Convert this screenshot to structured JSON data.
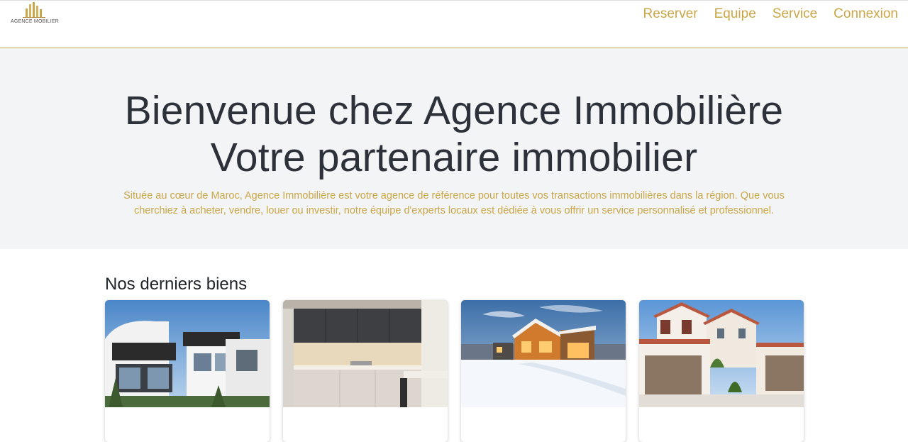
{
  "header": {
    "logo_text": "AGENCE MOBILIER",
    "nav": [
      "Reserver",
      "Equipe",
      "Service",
      "Connexion"
    ]
  },
  "hero": {
    "title_line1": "Bienvenue chez Agence Immobilière",
    "title_line2": "Votre partenaire immobilier",
    "description": "Située au cœur de Maroc, Agence Immobilière est votre agence de référence pour toutes vos transactions immobilières dans la région. Que vous cherchiez à acheter, vendre, louer ou investir, notre équipe d'experts locaux est dédiée à vous offrir un service personnalisé et professionnel."
  },
  "listings": {
    "heading": "Nos derniers biens",
    "cards": [
      {
        "image": "modern-white-villa"
      },
      {
        "image": "modern-kitchen"
      },
      {
        "image": "house-in-snow"
      },
      {
        "image": "white-mediterranean-house"
      }
    ]
  },
  "colors": {
    "accent": "#c9a646",
    "hero_bg": "#f3f4f6",
    "text": "#2c313a"
  }
}
